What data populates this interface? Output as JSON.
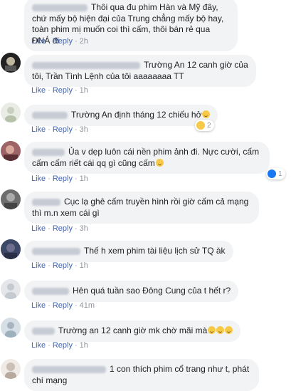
{
  "comments": [
    {
      "text": "Thôi qua đu phim Hàn và Mỹ đây, chứ mấy bộ hiện đại của Trung chẳng mấy bộ hay, toàn phim mị muốn coi thì cấm, thôi bán rẻ qua ĐNÁ đi",
      "like": "Like",
      "reply": "Reply",
      "time": "2h"
    },
    {
      "text": "Trường An 12 canh giờ của tôi, Trần Tình Lệnh của tôi aaaaaaaa TT",
      "like": "Like",
      "reply": "Reply",
      "time": "1h"
    },
    {
      "text": "Trường An định tháng 12 chiếu hở",
      "like": "Like",
      "reply": "Reply",
      "time": "3h",
      "reaction_count": "2"
    },
    {
      "text": "Ủa v dẹp luôn cái nền phim ảnh đi. Nực cười, cấm cấm cấm riết cái qq gì cũng cấm",
      "like": "Like",
      "reply": "Reply",
      "time": "1h",
      "reaction_count": "1"
    },
    {
      "text": "Cục lạ ghê cấm truyền hình rồi giờ cấm cả mạng thì m.n xem cái gì",
      "like": "Like",
      "reply": "Reply",
      "time": "3h"
    },
    {
      "text": "Thế h xem phim tài liệu lịch sử TQ àk",
      "like": "Like",
      "reply": "Reply",
      "time": "1h"
    },
    {
      "text": "Hên quá tuần sao Đông Cung của t hết r?",
      "like": "Like",
      "reply": "Reply",
      "time": "41m"
    },
    {
      "text": "Trường an 12 canh giờ mk chờ mãi mà",
      "like": "Like",
      "reply": "Reply",
      "time": "1h"
    },
    {
      "text": "1 con thích phim cổ trang như t, phát chí mạng"
    }
  ],
  "colors": {
    "bubble": "#f2f3f5",
    "link": "#4267b2",
    "meta": "#90949c",
    "like_blue": "#1877f2",
    "haha_yellow": "#f7c948"
  }
}
